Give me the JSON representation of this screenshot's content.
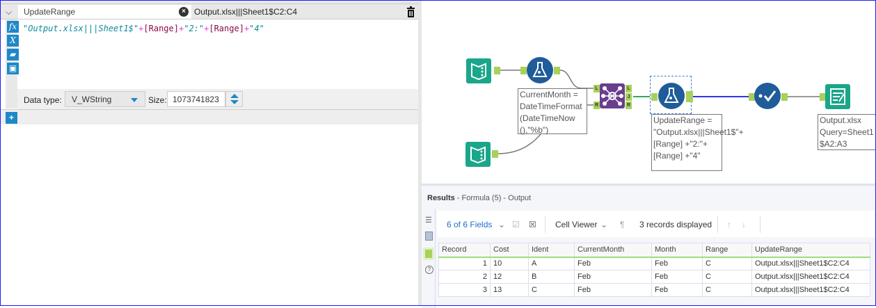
{
  "formula": {
    "field_name": "UpdateRange",
    "preview": "Output.xlsx|||Sheet1$C2:C4",
    "expression": [
      {
        "t": "\"Output.xlsx|||Sheet1$\"",
        "c": "s"
      },
      {
        "t": "+",
        "c": "op"
      },
      {
        "t": "[Range]",
        "c": "f"
      },
      {
        "t": "+",
        "c": "op"
      },
      {
        "t": "\"2:\"",
        "c": "s"
      },
      {
        "t": "+",
        "c": "op"
      },
      {
        "t": "[Range]",
        "c": "f"
      },
      {
        "t": "+",
        "c": "op"
      },
      {
        "t": "\"4\"",
        "c": "s"
      }
    ],
    "data_type_label": "Data type:",
    "data_type": "V_WString",
    "size_label": "Size:",
    "size": "1073741823",
    "icons": {
      "fx": "fx",
      "x": "X"
    }
  },
  "canvas": {
    "anno_formula1": "CurrentMonth = DateTimeFormat (DateTimeNow (),\"%b\")",
    "anno_formula2": "UpdateRange = \"Output.xlsx|||Sheet1$\"+[Range] +\"2:\"+[Range] +\"4\"",
    "anno_output": "Output.xlsx Query=Sheet1 $A2:A3",
    "join_anchors": {
      "l": "L",
      "r": "R",
      "j": "J"
    }
  },
  "results": {
    "title": "Results",
    "subtitle": "- Formula (5) - Output",
    "fields": "6 of 6 Fields",
    "viewer": "Cell Viewer",
    "records": "3 records displayed",
    "columns": [
      "Record",
      "Cost",
      "Ident",
      "CurrentMonth",
      "Month",
      "Range",
      "UpdateRange"
    ],
    "rows": [
      [
        "1",
        "10",
        "A",
        "Feb",
        "Feb",
        "C",
        "Output.xlsx|||Sheet1$C2:C4"
      ],
      [
        "2",
        "12",
        "B",
        "Feb",
        "Feb",
        "C",
        "Output.xlsx|||Sheet1$C2:C4"
      ],
      [
        "3",
        "13",
        "C",
        "Feb",
        "Feb",
        "C",
        "Output.xlsx|||Sheet1$C2:C4"
      ]
    ]
  },
  "colors": {
    "accent": "#1e88c8",
    "input": "#1aa68a",
    "formula": "#1f5c99",
    "join": "#6a3d8f",
    "anchor": "#a8d15a"
  }
}
